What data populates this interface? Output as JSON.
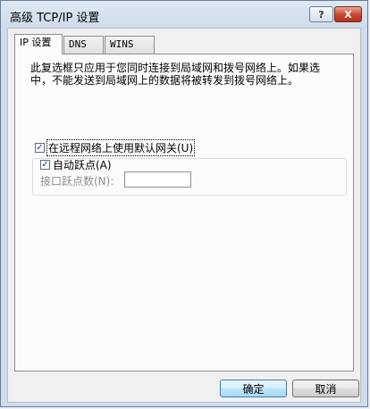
{
  "window": {
    "title": "高级 TCP/IP 设置",
    "help_glyph": "?",
    "close_glyph": "X"
  },
  "tabs": [
    {
      "label": "IP 设置",
      "active": true
    },
    {
      "label": "DNS",
      "active": false
    },
    {
      "label": "WINS",
      "active": false
    }
  ],
  "panel": {
    "description": "此复选框只应用于您同时连接到局域网和拨号网络上。如果选中，不能发送到局域网上的数据将被转发到拨号网络上。",
    "use_default_gateway": {
      "label": "在远程网络上使用默认网关(U)",
      "checked": true,
      "check_glyph": "✓"
    },
    "automatic_metric": {
      "label": "自动跃点(A)",
      "checked": true,
      "check_glyph": "✓"
    },
    "interface_metric": {
      "label": "接口跃点数(N):",
      "value": ""
    }
  },
  "buttons": {
    "ok": "确定",
    "cancel": "取消"
  }
}
